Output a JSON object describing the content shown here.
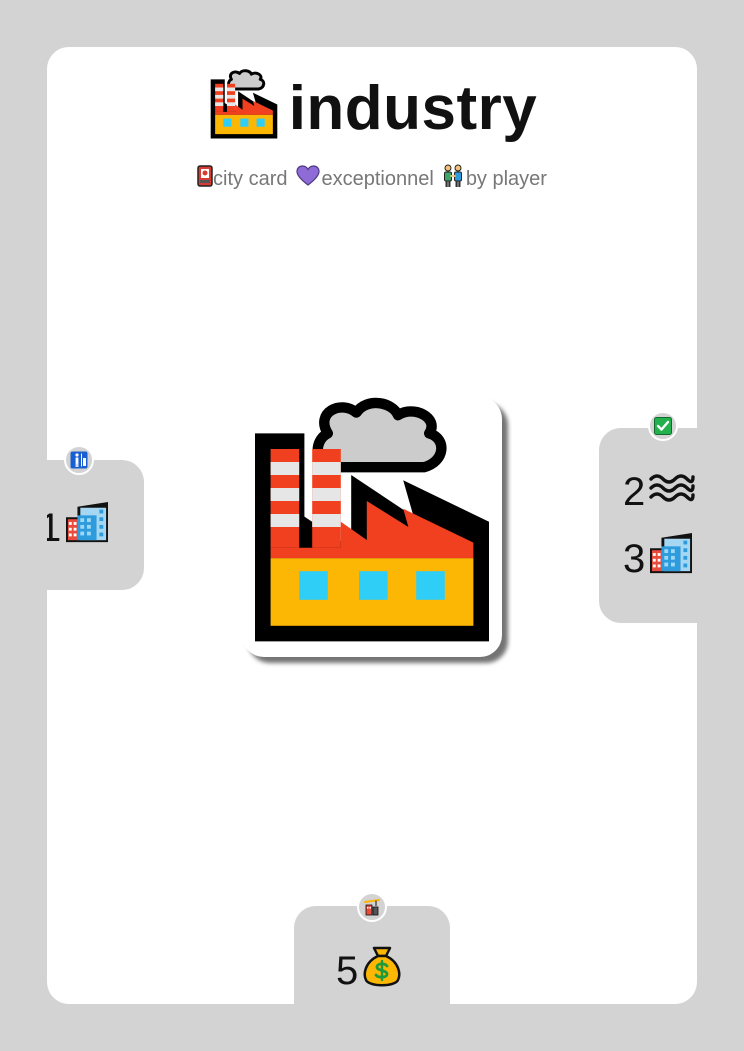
{
  "card": {
    "title": "industry",
    "title_icon": "factory-icon",
    "tags": [
      {
        "icon": "city-card-icon",
        "label": "city card"
      },
      {
        "icon": "purple-heart-icon",
        "label": "exceptionnel"
      },
      {
        "icon": "people-holding-hands-icon",
        "label": "by player"
      }
    ],
    "art_icon": "factory-icon",
    "left_panel": {
      "badge_icon": "restroom-person-icon",
      "items": [
        {
          "value": "1",
          "icon": "city-icon"
        }
      ]
    },
    "right_panel": {
      "badge_icon": "check-mark-button-icon",
      "items": [
        {
          "value": "2",
          "icon": "water-wave-icon"
        },
        {
          "value": "3",
          "icon": "city-icon"
        }
      ]
    },
    "bottom_panel": {
      "badge_icon": "building-construction-icon",
      "items": [
        {
          "value": "5",
          "icon": "money-bag-icon"
        }
      ]
    }
  },
  "colors": {
    "page_background": "#d3d3d3",
    "card_background": "#ffffff",
    "factory_red": "#f1401f",
    "factory_yellow": "#fcb704",
    "factory_window": "#2fcef6",
    "smoke": "#cccccc",
    "heart": "#8e6bd6"
  }
}
